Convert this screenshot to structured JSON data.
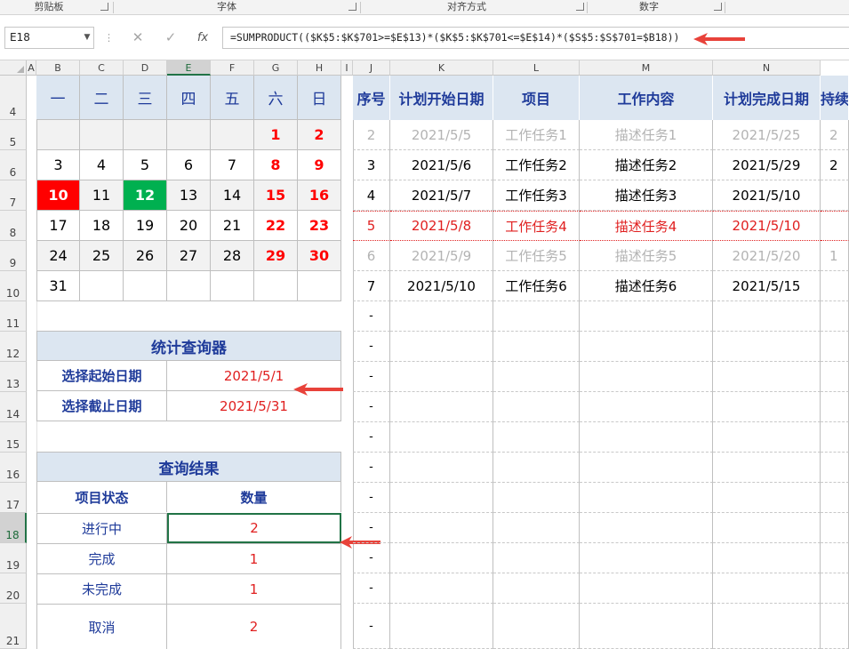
{
  "ribbon": {
    "groups": [
      "剪贴板",
      "字体",
      "对齐方式",
      "数字"
    ]
  },
  "formula_bar": {
    "name_box": "E18",
    "formula": "=SUMPRODUCT(($K$5:$K$701>=$E$13)*($K$5:$K$701<=$E$14)*($S$5:$S$701=$B18))",
    "cancel_icon": "✕",
    "enter_icon": "✓",
    "fx_icon": "fx"
  },
  "columns": [
    "A",
    "B",
    "C",
    "D",
    "E",
    "F",
    "G",
    "H",
    "I",
    "J",
    "K",
    "L",
    "M",
    "N"
  ],
  "rows": [
    "4",
    "5",
    "6",
    "7",
    "8",
    "9",
    "10",
    "11",
    "12",
    "13",
    "14",
    "15",
    "16",
    "17",
    "18",
    "19",
    "20",
    "21"
  ],
  "calendar": {
    "weekdays": [
      "一",
      "二",
      "三",
      "四",
      "五",
      "六",
      "日"
    ],
    "weeks": [
      [
        "",
        "",
        "",
        "",
        "",
        "1",
        "2"
      ],
      [
        "3",
        "4",
        "5",
        "6",
        "7",
        "8",
        "9"
      ],
      [
        "10",
        "11",
        "12",
        "13",
        "14",
        "15",
        "16"
      ],
      [
        "17",
        "18",
        "19",
        "20",
        "21",
        "22",
        "23"
      ],
      [
        "24",
        "25",
        "26",
        "27",
        "28",
        "29",
        "30"
      ],
      [
        "31",
        "",
        "",
        "",
        "",
        "",
        ""
      ]
    ],
    "highlight_red": "#ff0000",
    "highlight_green": "#00b050"
  },
  "query": {
    "title": "统计查询器",
    "start_label": "选择起始日期",
    "start_value": "2021/5/1",
    "end_label": "选择截止日期",
    "end_value": "2021/5/31"
  },
  "result": {
    "title": "查询结果",
    "col_status": "项目状态",
    "col_count": "数量",
    "rows": [
      {
        "status": "进行中",
        "count": "2"
      },
      {
        "status": "完成",
        "count": "1"
      },
      {
        "status": "未完成",
        "count": "1"
      },
      {
        "status": "取消",
        "count": "2"
      }
    ]
  },
  "task_table": {
    "headers": [
      "序号",
      "计划开始日期",
      "项目",
      "工作内容",
      "计划完成日期",
      "持续"
    ],
    "rows": [
      {
        "no": "2",
        "start": "2021/5/5",
        "project": "工作任务1",
        "content": "描述任务1",
        "end": "2021/5/25",
        "extra": "2",
        "style": "grey"
      },
      {
        "no": "3",
        "start": "2021/5/6",
        "project": "工作任务2",
        "content": "描述任务2",
        "end": "2021/5/29",
        "extra": "2",
        "style": "normal"
      },
      {
        "no": "4",
        "start": "2021/5/7",
        "project": "工作任务3",
        "content": "描述任务3",
        "end": "2021/5/10",
        "extra": "",
        "style": "normal"
      },
      {
        "no": "5",
        "start": "2021/5/8",
        "project": "工作任务4",
        "content": "描述任务4",
        "end": "2021/5/10",
        "extra": "",
        "style": "red"
      },
      {
        "no": "6",
        "start": "2021/5/9",
        "project": "工作任务5",
        "content": "描述任务5",
        "end": "2021/5/20",
        "extra": "1",
        "style": "grey"
      },
      {
        "no": "7",
        "start": "2021/5/10",
        "project": "工作任务6",
        "content": "描述任务6",
        "end": "2021/5/15",
        "extra": "",
        "style": "normal"
      }
    ],
    "empty_marker": "-"
  },
  "colors": {
    "header_fill": "#dce6f1",
    "header_text": "#1f3b9a",
    "accent_red": "#e02020",
    "arrow_red": "#e8423a",
    "selection_green": "#217346"
  }
}
